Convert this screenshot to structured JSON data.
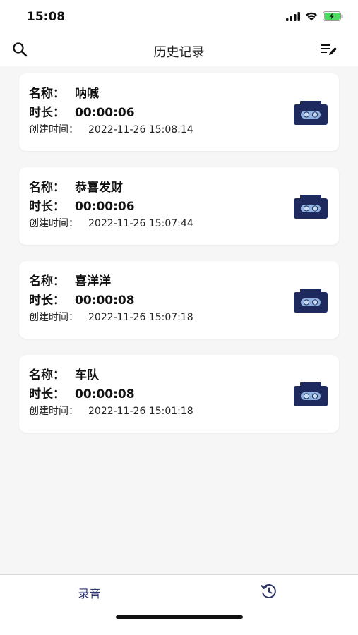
{
  "status_bar": {
    "time": "15:08",
    "icons": [
      "signal-icon",
      "wifi-icon",
      "battery-charging-icon"
    ],
    "battery_color": "#4cd964"
  },
  "nav": {
    "title": "历史记录",
    "left_icon": "search-icon",
    "right_icon": "edit-list-icon"
  },
  "labels": {
    "name": "名称：",
    "duration": "时长：",
    "created": "创建时间："
  },
  "records": [
    {
      "name": "呐喊",
      "duration": "00:00:06",
      "created": "2022-11-26 15:08:14"
    },
    {
      "name": "恭喜发财",
      "duration": "00:00:06",
      "created": "2022-11-26 15:07:44"
    },
    {
      "name": "喜洋洋",
      "duration": "00:00:08",
      "created": "2022-11-26 15:07:18"
    },
    {
      "name": "车队",
      "duration": "00:00:08",
      "created": "2022-11-26 15:01:18"
    }
  ],
  "record_icon": "cassette-tape-icon",
  "colors": {
    "accent": "#1e2a5e",
    "cassette_window": "#8fb3de",
    "background": "#f6f6f6",
    "card": "#ffffff"
  },
  "tab_bar": {
    "tabs": [
      {
        "label": "录音"
      },
      {
        "icon": "history-clock-icon"
      }
    ]
  }
}
